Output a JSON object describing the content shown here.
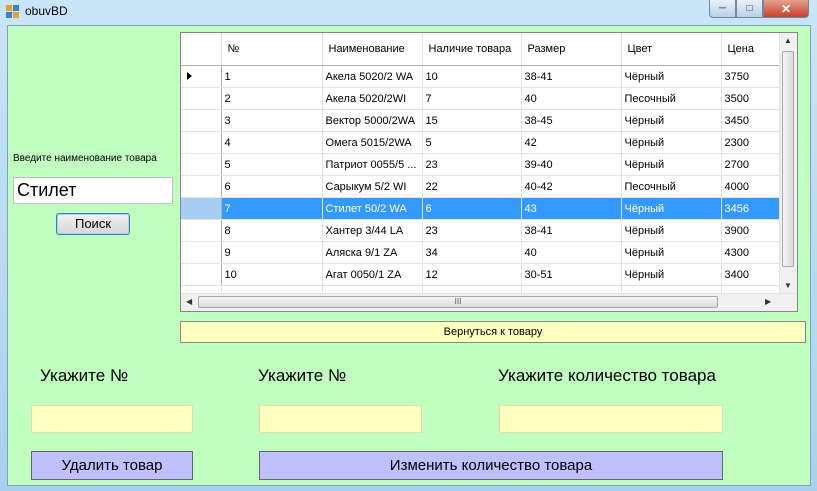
{
  "window": {
    "title": "obuvBD"
  },
  "search": {
    "label": "Введите наименование товара",
    "value": "Стилет",
    "button": "Поиск"
  },
  "grid": {
    "columns": [
      "№",
      "Наименование",
      "Наличие товара",
      "Размер",
      "Цвет",
      "Цена"
    ],
    "rows": [
      [
        "1",
        "Акела 5020/2 WA",
        "10",
        "38-41",
        "Чёрный",
        "3750"
      ],
      [
        "2",
        "Акела 5020/2WI",
        "7",
        "40",
        "Песочный",
        "3500"
      ],
      [
        "3",
        "Вектор 5000/2WA",
        "15",
        "38-45",
        "Чёрный",
        "3450"
      ],
      [
        "4",
        "Омега 5015/2WA",
        "5",
        "42",
        "Чёрный",
        "2300"
      ],
      [
        "5",
        "Патриот 0055/5 ...",
        "23",
        "39-40",
        "Чёрный",
        "2700"
      ],
      [
        "6",
        "Сарыкум 5/2 WI",
        "22",
        "40-42",
        "Песочный",
        "4000"
      ],
      [
        "7",
        "Стилет 50/2 WA",
        "6",
        "43",
        "Чёрный",
        "3456"
      ],
      [
        "8",
        "Хантер 3/44 LA",
        "23",
        "38-41",
        "Чёрный",
        "3900"
      ],
      [
        "9",
        "Аляска 9/1 ZA",
        "34",
        "40",
        "Чёрный",
        "4300"
      ],
      [
        "10",
        "Агат 0050/1 ZA",
        "12",
        "30-51",
        "Чёрный",
        "3400"
      ]
    ],
    "selected_row": 6,
    "current_row": 0,
    "hscroll_label": "III"
  },
  "back_button": "Вернуться к товару",
  "form": {
    "label1": "Укажите №",
    "label2": "Укажите №",
    "label3": "Укажите количество товара",
    "field1": "",
    "field2": "",
    "field3": "",
    "delete_button": "Удалить товар",
    "change_button": "Изменить количество товара"
  }
}
